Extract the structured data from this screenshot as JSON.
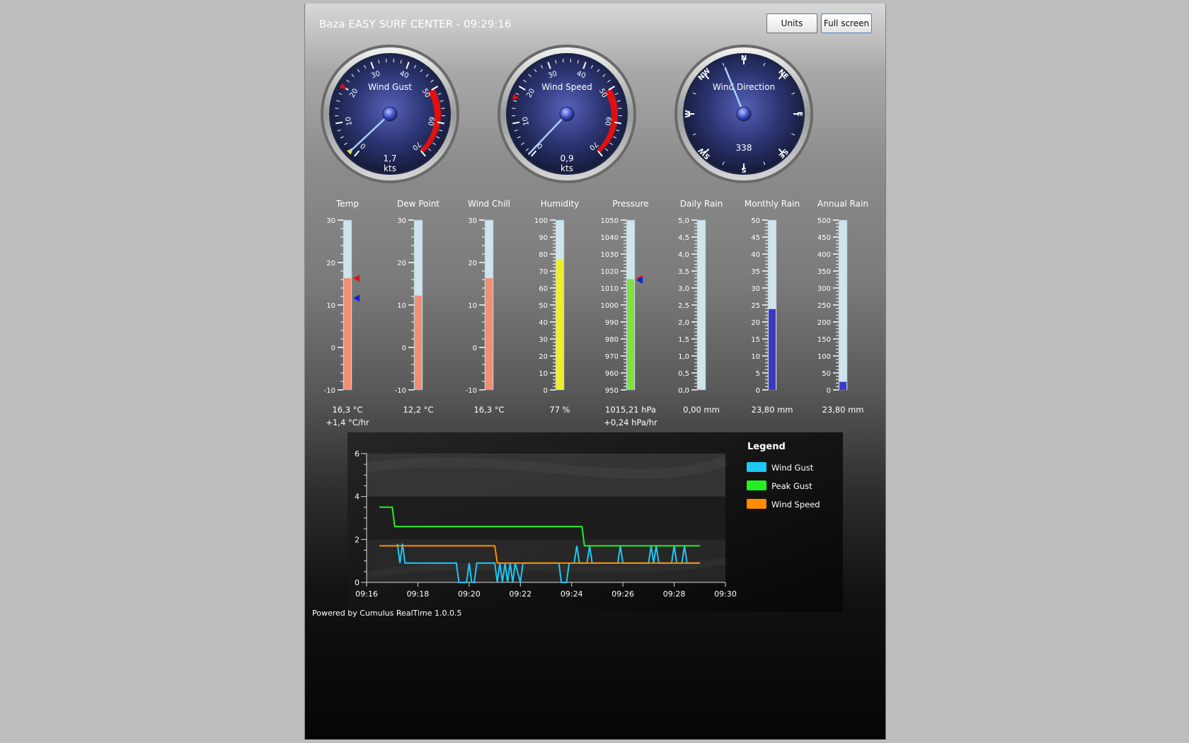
{
  "header": {
    "title": "Baza EASY SURF CENTER - 09:29:16",
    "units_label": "Units",
    "fullscreen_label": "Full screen"
  },
  "colors": {
    "temp_fill": "#f18f73",
    "humidity_fill": "#eeee2a",
    "pressure_fill": "#7fe23e",
    "rain_fill": "#3a3ac4",
    "tube_bg": "#cfe4ec",
    "needle": "#aad0f8",
    "redline": "#e01010"
  },
  "gauges": [
    {
      "id": "wind-gust",
      "label": "Wind Gust",
      "type": "speed",
      "value": 1.7,
      "value_text": "1,7",
      "unit": "kts",
      "ticks": [
        "0",
        "10",
        "20",
        "30",
        "40",
        "50",
        "60",
        "70"
      ],
      "red_marker": 20,
      "yellow_marker": 1.7
    },
    {
      "id": "wind-speed",
      "label": "Wind Speed",
      "type": "speed",
      "value": 0.9,
      "value_text": "0,9",
      "unit": "kts",
      "ticks": [
        "0",
        "10",
        "20",
        "30",
        "40",
        "50",
        "60",
        "70"
      ],
      "red_marker": 17
    },
    {
      "id": "wind-direction",
      "label": "Wind Direction",
      "type": "compass",
      "value": 338,
      "value_text": "338",
      "points": [
        "N",
        "NE",
        "E",
        "SE",
        "S",
        "SW",
        "W",
        "NW"
      ]
    }
  ],
  "thermometers": [
    {
      "id": "temp",
      "label": "Temp",
      "ticks": [
        "30",
        "20",
        "10",
        "0",
        "-10"
      ],
      "min": -10,
      "max": 30,
      "value": 16.3,
      "fill": "temp",
      "value_text": "16,3 °C",
      "trend_text": "+1,4  °C/hr",
      "markers": [
        {
          "value": 16.3,
          "color": "#e01010"
        },
        {
          "value": 11.6,
          "color": "#1020e0"
        }
      ]
    },
    {
      "id": "dew-point",
      "label": "Dew Point",
      "ticks": [
        "30",
        "20",
        "10",
        "0",
        "-10"
      ],
      "min": -10,
      "max": 30,
      "value": 12.2,
      "fill": "temp",
      "value_text": "12,2 °C"
    },
    {
      "id": "wind-chill",
      "label": "Wind Chill",
      "ticks": [
        "30",
        "20",
        "10",
        "0",
        "-10"
      ],
      "min": -10,
      "max": 30,
      "value": 16.3,
      "fill": "temp",
      "value_text": "16,3 °C"
    },
    {
      "id": "humidity",
      "label": "Humidity",
      "ticks": [
        "100",
        "90",
        "80",
        "70",
        "60",
        "50",
        "40",
        "30",
        "20",
        "10",
        "0"
      ],
      "min": 0,
      "max": 100,
      "value": 77,
      "fill": "humidity",
      "value_text": "77  %"
    },
    {
      "id": "pressure",
      "label": "Pressure",
      "ticks": [
        "1050",
        "1040",
        "1030",
        "1020",
        "1010",
        "1000",
        "990",
        "980",
        "970",
        "960",
        "950"
      ],
      "min": 950,
      "max": 1050,
      "value": 1015.21,
      "fill": "pressure",
      "value_text": "1015,21  hPa",
      "trend_text": "+0,24  hPa/hr",
      "markers": [
        {
          "value": 1015.5,
          "color": "#e01010"
        },
        {
          "value": 1014.6,
          "color": "#1020e0"
        }
      ]
    },
    {
      "id": "daily-rain",
      "label": "Daily Rain",
      "ticks": [
        "5,0",
        "4,5",
        "4,0",
        "3,5",
        "3,0",
        "2,5",
        "2,0",
        "1,5",
        "1,0",
        "0,5",
        "0,0"
      ],
      "min": 0,
      "max": 5,
      "value": 0,
      "fill": "rain",
      "value_text": "0,00  mm"
    },
    {
      "id": "monthly-rain",
      "label": "Monthly Rain",
      "ticks": [
        "50",
        "45",
        "40",
        "35",
        "30",
        "25",
        "20",
        "15",
        "10",
        "5",
        "0"
      ],
      "min": 0,
      "max": 50,
      "value": 23.8,
      "fill": "rain",
      "value_text": "23,80  mm"
    },
    {
      "id": "annual-rain",
      "label": "Annual Rain",
      "ticks": [
        "500",
        "450",
        "400",
        "350",
        "300",
        "250",
        "200",
        "150",
        "100",
        "50",
        "0"
      ],
      "min": 0,
      "max": 500,
      "value": 23.8,
      "fill": "rain",
      "value_text": "23,80  mm"
    }
  ],
  "chart_data": {
    "type": "line",
    "x_ticks": [
      "09:16",
      "09:18",
      "09:20",
      "09:22",
      "09:24",
      "09:26",
      "09:28",
      "09:30"
    ],
    "xlim": [
      "09:16",
      "09:30"
    ],
    "y_ticks": [
      "0",
      "2",
      "4",
      "6"
    ],
    "ylim": [
      0,
      6
    ],
    "legend_title": "Legend",
    "legend_position": "right",
    "series": [
      {
        "name": "Wind Gust",
        "color": "#1ec8f5",
        "points": [
          [
            "09:17.2",
            1.8
          ],
          [
            "09:17.3",
            0.9
          ],
          [
            "09:17.4",
            1.8
          ],
          [
            "09:17.5",
            0.9
          ],
          [
            "09:19.5",
            0.9
          ],
          [
            "09:19.6",
            0
          ],
          [
            "09:19.9",
            0
          ],
          [
            "09:20.0",
            0.9
          ],
          [
            "09:20.1",
            0
          ],
          [
            "09:20.2",
            0
          ],
          [
            "09:20.3",
            0.9
          ],
          [
            "09:21.0",
            0.9
          ],
          [
            "09:21.1",
            0
          ],
          [
            "09:21.2",
            0.9
          ],
          [
            "09:21.3",
            0
          ],
          [
            "09:21.4",
            0.9
          ],
          [
            "09:21.5",
            0
          ],
          [
            "09:21.6",
            0.9
          ],
          [
            "09:21.7",
            0
          ],
          [
            "09:21.8",
            0.9
          ],
          [
            "09:22.0",
            0
          ],
          [
            "09:22.1",
            0.9
          ],
          [
            "09:23.5",
            0.9
          ],
          [
            "09:23.6",
            0
          ],
          [
            "09:23.8",
            0
          ],
          [
            "09:23.9",
            0.9
          ],
          [
            "09:24.1",
            0.9
          ],
          [
            "09:24.2",
            1.7
          ],
          [
            "09:24.3",
            0.9
          ],
          [
            "09:24.6",
            0.9
          ],
          [
            "09:24.7",
            1.7
          ],
          [
            "09:24.8",
            0.9
          ],
          [
            "09:25.8",
            0.9
          ],
          [
            "09:25.9",
            1.7
          ],
          [
            "09:26.0",
            0.9
          ],
          [
            "09:27.0",
            0.9
          ],
          [
            "09:27.1",
            1.7
          ],
          [
            "09:27.2",
            0.9
          ],
          [
            "09:27.3",
            1.7
          ],
          [
            "09:27.4",
            0.9
          ],
          [
            "09:27.9",
            0.9
          ],
          [
            "09:28.0",
            1.7
          ],
          [
            "09:28.1",
            0.9
          ],
          [
            "09:28.3",
            0.9
          ],
          [
            "09:28.4",
            1.7
          ],
          [
            "09:28.5",
            0.9
          ],
          [
            "09:29.0",
            0.9
          ]
        ]
      },
      {
        "name": "Peak Gust",
        "color": "#22f022",
        "points": [
          [
            "09:16.5",
            3.5
          ],
          [
            "09:17.0",
            3.5
          ],
          [
            "09:17.1",
            2.6
          ],
          [
            "09:24.4",
            2.6
          ],
          [
            "09:24.5",
            1.7
          ],
          [
            "09:29.0",
            1.7
          ]
        ]
      },
      {
        "name": "Wind Speed",
        "color": "#ff8c00",
        "points": [
          [
            "09:16.5",
            1.7
          ],
          [
            "09:21.0",
            1.7
          ],
          [
            "09:21.1",
            0.9
          ],
          [
            "09:29.0",
            0.9
          ]
        ]
      }
    ]
  },
  "footer": {
    "text": "Powered by Cumulus RealTime 1.0.0.5"
  }
}
